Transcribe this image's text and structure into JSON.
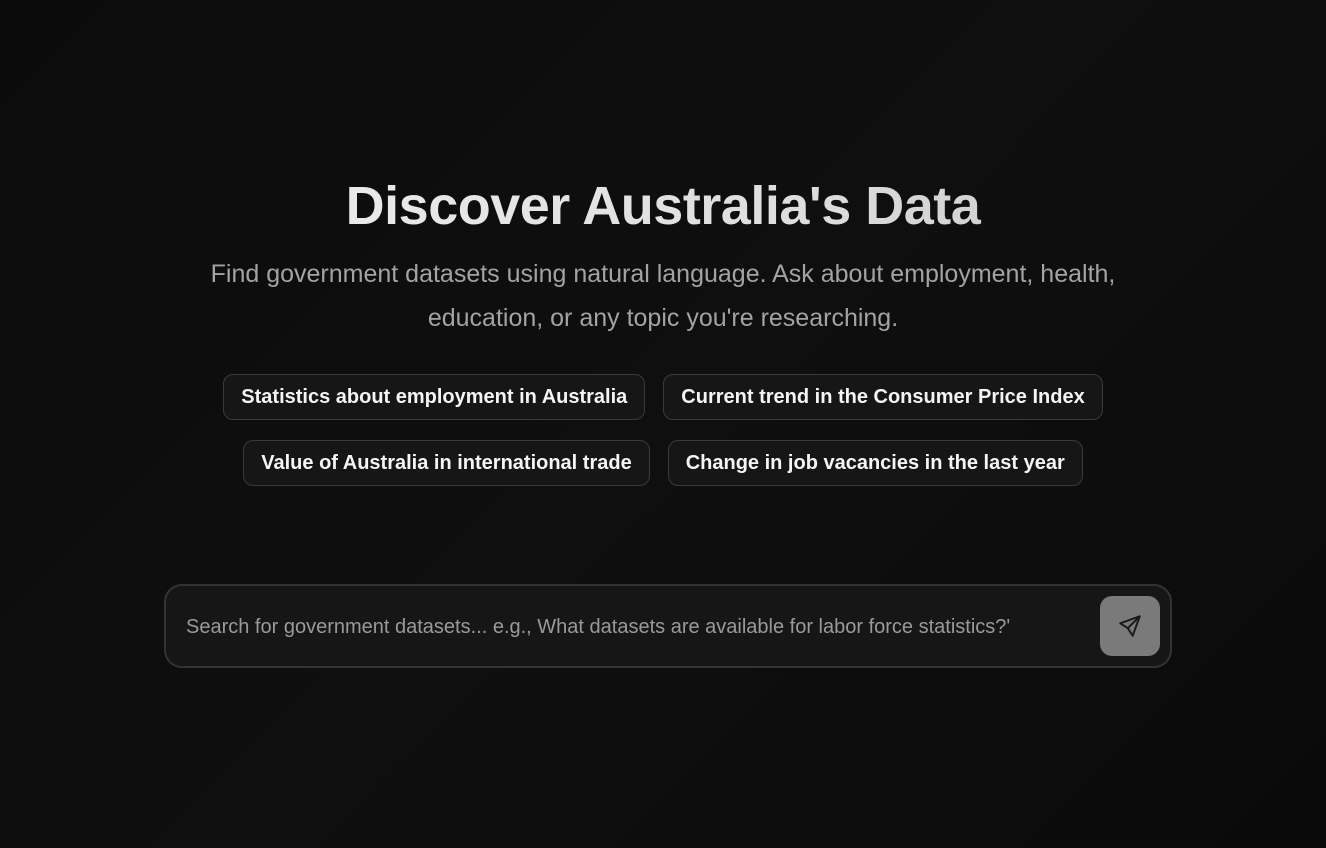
{
  "hero": {
    "title": "Discover Australia's Data",
    "subtitle": "Find government datasets using natural language. Ask about employment, health, education, or any topic you're researching."
  },
  "suggestions": [
    "Statistics about employment in Australia",
    "Current trend in the Consumer Price Index",
    "Value of Australia in international trade",
    "Change in job vacancies in the last year"
  ],
  "search": {
    "placeholder": "Search for government datasets... e.g., What datasets are available for labor force statistics?'",
    "value": "",
    "send_icon": "send-icon"
  },
  "colors": {
    "background": "#0c0c0c",
    "chip_background": "#161616",
    "chip_border": "#3a3a3a",
    "send_button": "#7a7a7a",
    "subtitle_text": "#a3a3a3"
  }
}
